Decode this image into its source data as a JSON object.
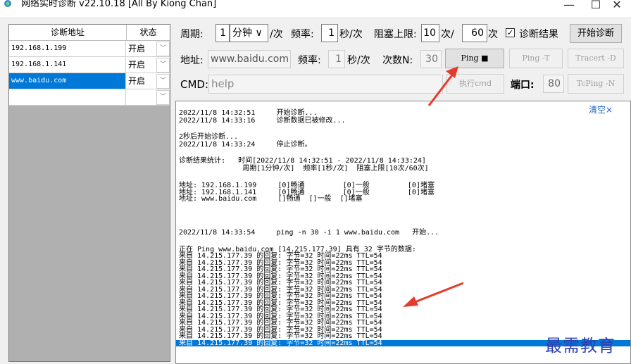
{
  "window": {
    "title": "网络实时诊断 v22.10.18 [All By Kiong Chan]",
    "min_glyph": "—",
    "max_glyph": "☐",
    "close_glyph": "✕"
  },
  "grid": {
    "col_addr": "诊断地址",
    "col_status": "状态",
    "rows": [
      {
        "addr": "192.168.1.199",
        "status": "开启"
      },
      {
        "addr": "192.168.1.141",
        "status": "开启"
      },
      {
        "addr": "www.baidu.com",
        "status": "开启"
      },
      {
        "addr": "",
        "status": ""
      }
    ],
    "dropdown_glyph": "﹀"
  },
  "row1": {
    "period_label": "周期:",
    "period_value": "1",
    "unit_select": "分钟 ∨",
    "per_label": "/次",
    "freq_label": "频率:",
    "freq_value": "1",
    "freq_unit": "秒/次",
    "block_label": "阻塞上限:",
    "block_a": "10",
    "block_a_unit": "次/",
    "block_b": "60",
    "block_b_unit": "次",
    "result_check": "✓",
    "result_label": "诊断结果",
    "start_button": "开始诊断"
  },
  "row2": {
    "addr_label": "地址:",
    "addr_value": "www.baidu.com",
    "freq_label": "频率:",
    "freq_value": "1",
    "freq_unit": "秒/次",
    "count_label": "次数N:",
    "count_value": "30",
    "ping_button": "Ping ■",
    "pingt_button": "Ping -T",
    "tracert_button": "Tracert -D",
    "tcping_button": "TcPing -N"
  },
  "row3": {
    "cmd_label": "CMD:",
    "cmd_value": "help",
    "exec_button": "执行cmd",
    "port_label": "端口:",
    "port_value": "80"
  },
  "log": {
    "clear_label": "清空×",
    "lines": [
      "2022/11/8 14:32:51     开始诊断...",
      "2022/11/8 14:33:16     诊断数据已被修改...",
      "",
      "2秒后开始诊断...",
      "2022/11/8 14:33:24     停止诊断。",
      "",
      "诊断结果统计:   时间[2022/11/8 14:32:51 - 2022/11/8 14:33:24]",
      "               周期[1分钟/次]  频率[1秒/次]  阻塞上限[10次/60次]",
      "",
      "地址: 192.168.1.199     [0]畅通         [0]一般         [0]堵塞",
      "地址: 192.168.1.141     [0]畅通         [0]一般         [0]堵塞",
      "地址: www.baidu.com     []畅通  []一般  []堵塞",
      "",
      "",
      "",
      "2022/11/8 14:33:54     ping -n 30 -i 1 www.baidu.com   开始...",
      "",
      "正在 Ping www.baidu.com [14.215.177.39] 具有 32 字节的数据:",
      "来自 14.215.177.39 的回复: 字节=32 时间=22ms TTL=54",
      "来自 14.215.177.39 的回复: 字节=32 时间=22ms TTL=54",
      "来自 14.215.177.39 的回复: 字节=32 时间=22ms TTL=54",
      "来自 14.215.177.39 的回复: 字节=32 时间=22ms TTL=54",
      "来自 14.215.177.39 的回复: 字节=32 时间=22ms TTL=54",
      "来自 14.215.177.39 的回复: 字节=32 时间=22ms TTL=54",
      "来自 14.215.177.39 的回复: 字节=32 时间=22ms TTL=54",
      "来自 14.215.177.39 的回复: 字节=32 时间=22ms TTL=54",
      "来自 14.215.177.39 的回复: 字节=32 时间=22ms TTL=54",
      "来自 14.215.177.39 的回复: 字节=32 时间=22ms TTL=54",
      "来自 14.215.177.39 的回复: 字节=32 时间=22ms TTL=54",
      "来自 14.215.177.39 的回复: 字节=32 时间=22ms TTL=54",
      "来自 14.215.177.39 的回复: 字节=32 时间=22ms TTL=54",
      "来自 14.215.177.39 的回复: 字节=32 时间=22ms TTL=54"
    ],
    "highlight_last": true
  },
  "watermark": "最需教育",
  "colors": {
    "accent": "#0078d7",
    "annotation_arrow": "#e53b2c",
    "watermark": "#2b3eb1"
  }
}
